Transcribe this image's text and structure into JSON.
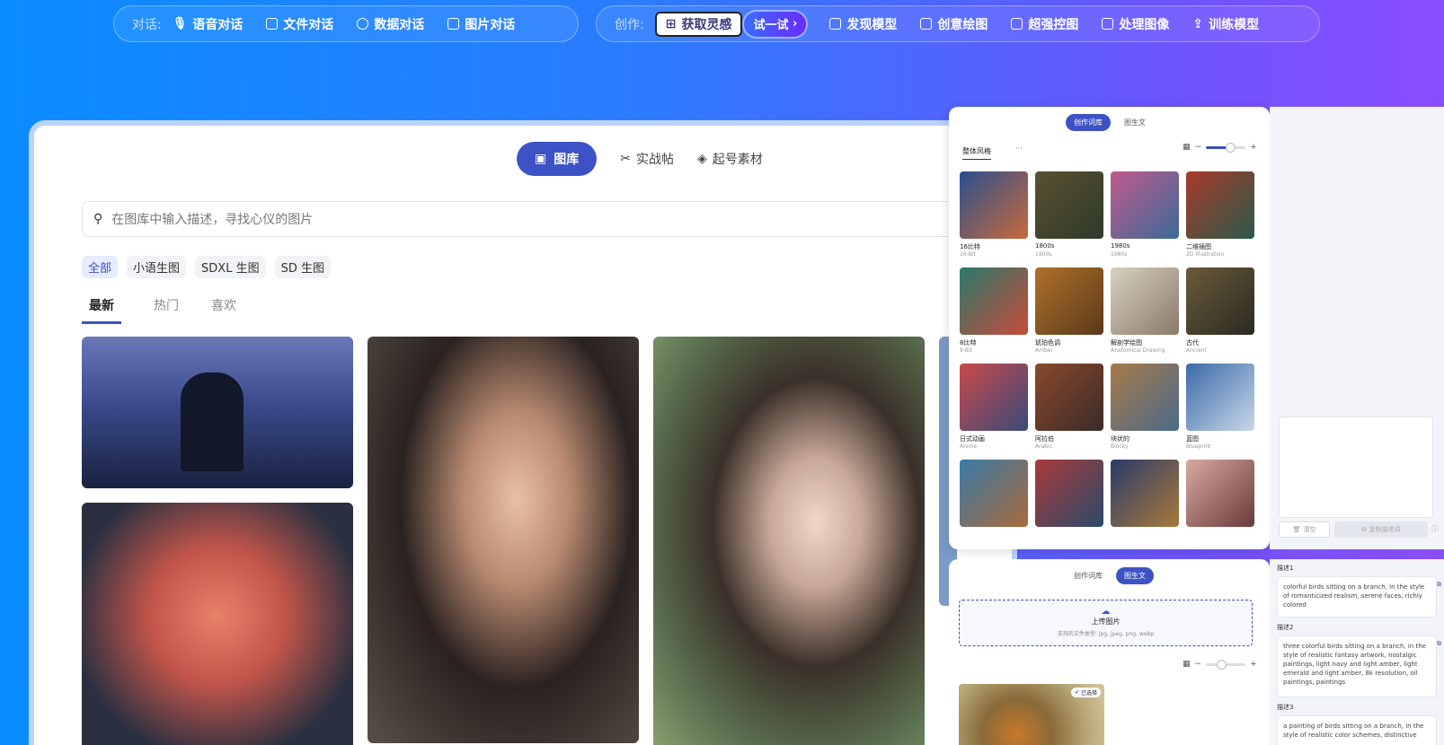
{
  "nav_chat": {
    "label": "对话:",
    "items": [
      "语音对话",
      "文件对话",
      "数据对话",
      "图片对话"
    ]
  },
  "nav_create": {
    "label": "创作:",
    "inspire": "获取灵感",
    "try": "试一试",
    "items": [
      "发现模型",
      "创意绘图",
      "超强控图",
      "处理图像",
      "训练模型"
    ]
  },
  "main": {
    "tabs": [
      "图库",
      "实战帖",
      "起号素材"
    ],
    "search_placeholder": "在图库中输入描述，寻找心仪的图片",
    "chips": [
      "全部",
      "小语生图",
      "SDXL 生图",
      "SD 生图"
    ],
    "sort": [
      "最新",
      "热门",
      "喜欢"
    ]
  },
  "panel": {
    "tabs": [
      "创作词库",
      "图生文"
    ],
    "category": "整体风格",
    "more": "···",
    "styles": [
      {
        "zh": "16比特",
        "en": "16-Bit",
        "c1": "#2b4f8f",
        "c2": "#c86a3a"
      },
      {
        "zh": "1800s",
        "en": "1800s",
        "c1": "#5a5030",
        "c2": "#2e3a2a"
      },
      {
        "zh": "1980s",
        "en": "1980s",
        "c1": "#c05a8a",
        "c2": "#3a6a9a"
      },
      {
        "zh": "二维插图",
        "en": "2D Illustration",
        "c1": "#a83a2a",
        "c2": "#2a5a4a"
      },
      {
        "zh": "8比特",
        "en": "8-Bit",
        "c1": "#2a7a6a",
        "c2": "#c84a3a"
      },
      {
        "zh": "琥珀色调",
        "en": "Amber",
        "c1": "#b0702a",
        "c2": "#5a3a1a"
      },
      {
        "zh": "解剖学绘图",
        "en": "Anatomical Drawing",
        "c1": "#d8d0c0",
        "c2": "#8a7a6a"
      },
      {
        "zh": "古代",
        "en": "Ancient",
        "c1": "#6a5a3a",
        "c2": "#2a2a22"
      },
      {
        "zh": "日式动画",
        "en": "Anime",
        "c1": "#c84a4a",
        "c2": "#3a4a7a"
      },
      {
        "zh": "阿拉伯",
        "en": "Arabic",
        "c1": "#8a4a2a",
        "c2": "#3a2a2a"
      },
      {
        "zh": "块状的",
        "en": "Blocky",
        "c1": "#a87a4a",
        "c2": "#4a6a8a"
      },
      {
        "zh": "蓝图",
        "en": "Blueprint",
        "c1": "#3a6aa8",
        "c2": "#c8d8e8"
      },
      {
        "zh": "",
        "en": "",
        "c1": "#3a7aa8",
        "c2": "#a86a3a"
      },
      {
        "zh": "",
        "en": "",
        "c1": "#a83a3a",
        "c2": "#2a4a6a"
      },
      {
        "zh": "",
        "en": "",
        "c1": "#2a3a6a",
        "c2": "#a87a3a"
      },
      {
        "zh": "",
        "en": "",
        "c1": "#d8a8a0",
        "c2": "#6a3a3a"
      }
    ]
  },
  "side": {
    "clear": "清空",
    "copy": "复制描述词"
  },
  "panel2": {
    "tabs": [
      "创作词库",
      "图生文"
    ],
    "upload": "上传图片",
    "types": "支持的文件类型: jpg, jpeg, png, webp",
    "selected": "已选择"
  },
  "descriptions": [
    {
      "label": "描述1",
      "text": "colorful birds sitting on a branch, in the style of romanticized realism, serene faces, richly colored"
    },
    {
      "label": "描述2",
      "text": "three colorful birds sitting on a branch, in the style of realistic fantasy artwork, nostalgic paintings, light navy and light amber, light emerald and light amber, 8k resolution, oil paintings, paintings"
    },
    {
      "label": "描述3",
      "text": "a painting of birds sitting on a branch, in the style of realistic color schemes, distinctive"
    }
  ],
  "colors": {
    "accent": "#3d52c4"
  }
}
